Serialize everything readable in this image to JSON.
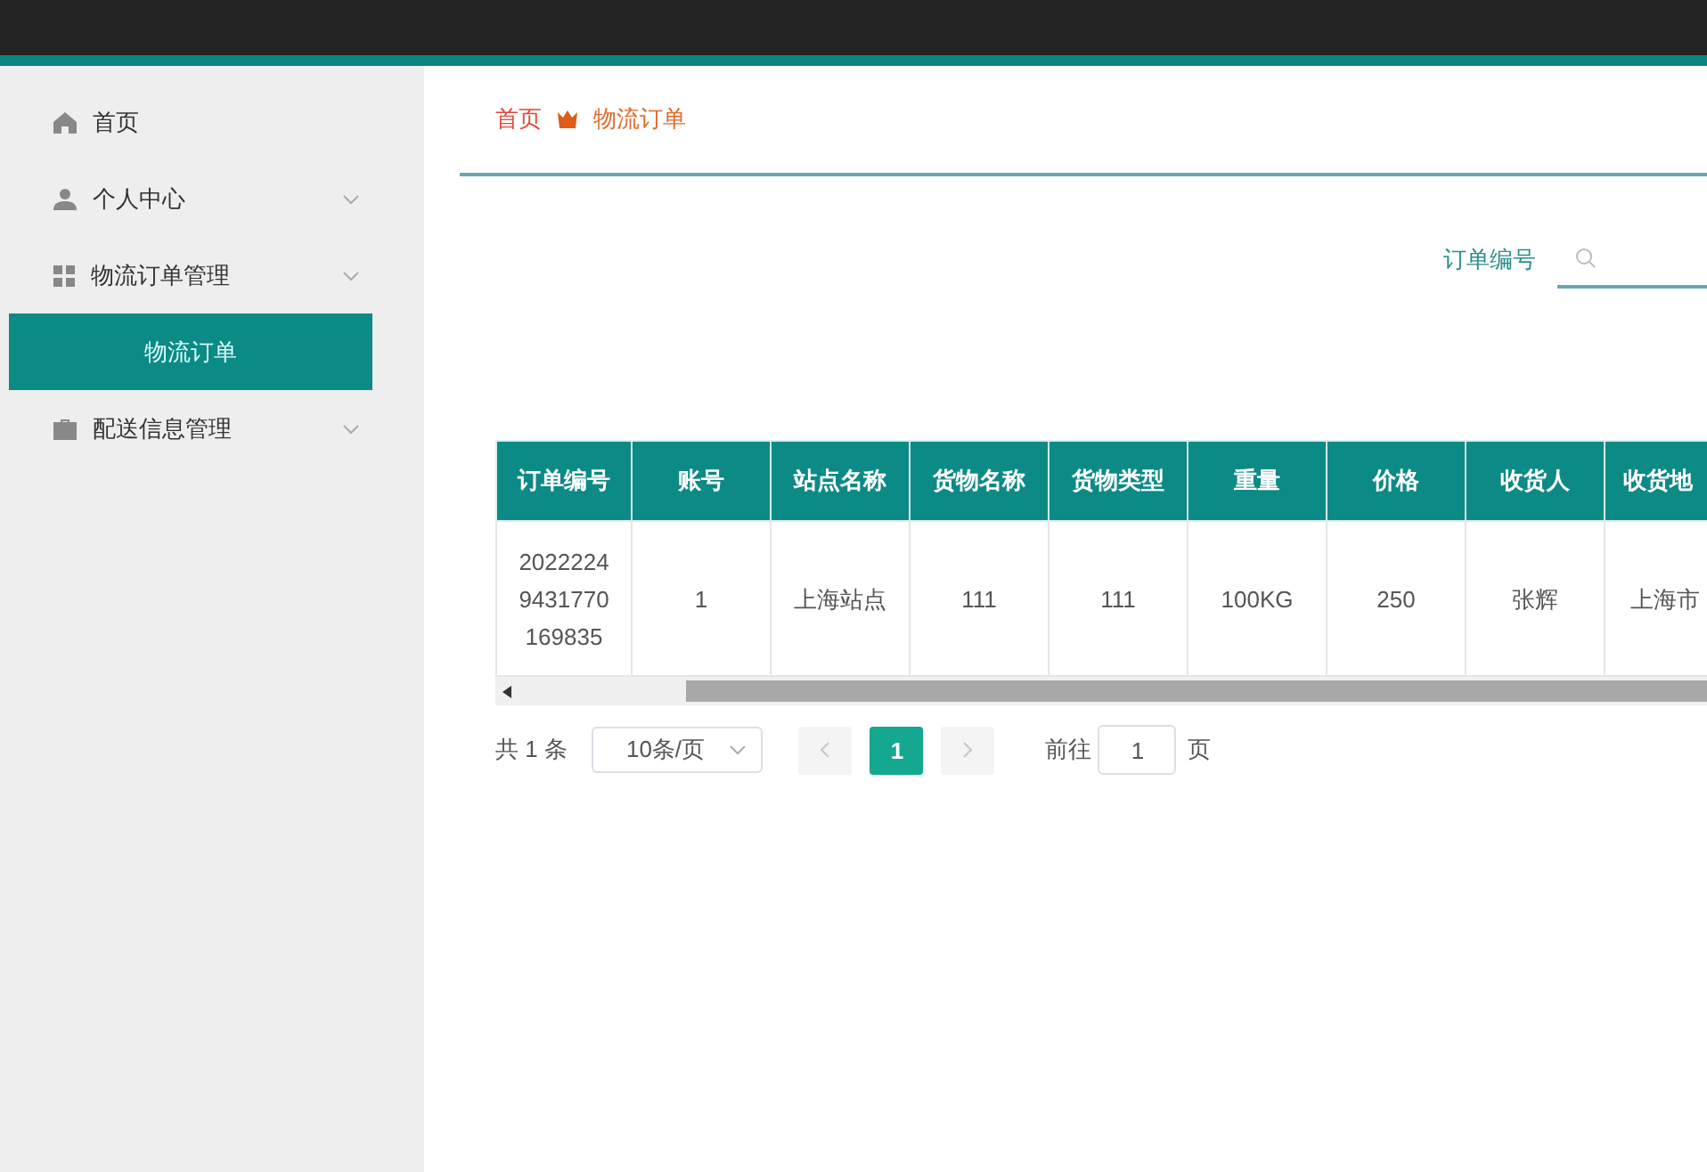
{
  "sidebar": {
    "items": [
      {
        "label": "首页",
        "kind": "link"
      },
      {
        "label": "个人中心",
        "kind": "group"
      },
      {
        "label": "物流订单管理",
        "kind": "group",
        "children": [
          {
            "label": "物流订单",
            "selected": true
          }
        ]
      },
      {
        "label": "配送信息管理",
        "kind": "group"
      }
    ]
  },
  "breadcrumb": [
    "首页",
    "物流订单"
  ],
  "search": {
    "label": "订单编号"
  },
  "table": {
    "columns": [
      "订单编号",
      "账号",
      "站点名称",
      "货物名称",
      "货物类型",
      "重量",
      "价格",
      "收货人",
      "收货地"
    ],
    "rows": [
      [
        "20222249431770169835",
        "1",
        "上海站点",
        "111",
        "111",
        "100KG",
        "250",
        "张辉",
        "上海市"
      ]
    ]
  },
  "pagination": {
    "total": "共 1 条",
    "page_size": "10条/页",
    "prev_disabled": true,
    "next_disabled": true,
    "pages": [
      {
        "label": "1",
        "selected": true
      }
    ],
    "goto_label": "前往",
    "goto_value": "1",
    "goto_suffix": "页"
  }
}
